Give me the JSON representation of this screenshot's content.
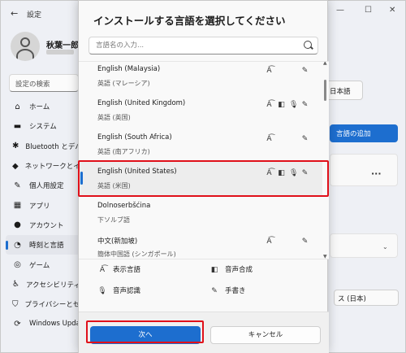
{
  "window": {
    "app_title": "設定",
    "back_glyph": "←",
    "minimize_glyph": "—",
    "maximize_glyph": "☐",
    "close_glyph": "✕"
  },
  "user": {
    "name": "秋葉一郎"
  },
  "sidebar": {
    "search_placeholder": "設定の検索",
    "items": [
      {
        "label": "ホーム",
        "icon": "home-icon",
        "glyph": "⌂"
      },
      {
        "label": "システム",
        "icon": "system-icon",
        "glyph": "▬"
      },
      {
        "label": "Bluetooth とデバ",
        "icon": "bluetooth-icon",
        "glyph": "✱"
      },
      {
        "label": "ネットワークとインタ",
        "icon": "network-icon",
        "glyph": "◆"
      },
      {
        "label": "個人用設定",
        "icon": "personalize-icon",
        "glyph": "✎"
      },
      {
        "label": "アプリ",
        "icon": "apps-icon",
        "glyph": "▦"
      },
      {
        "label": "アカウント",
        "icon": "account-icon",
        "glyph": "●"
      },
      {
        "label": "時刻と言語",
        "icon": "time-language-icon",
        "glyph": "◔",
        "active": true
      },
      {
        "label": "ゲーム",
        "icon": "game-icon",
        "glyph": "◎"
      },
      {
        "label": "アクセシビリティ",
        "icon": "accessibility-icon",
        "glyph": "♿"
      },
      {
        "label": "プライバシーとセキュ",
        "icon": "shield-icon",
        "glyph": "⛉"
      },
      {
        "label": "Windows Upda",
        "icon": "update-icon",
        "glyph": "⟳"
      }
    ]
  },
  "right": {
    "lang_box": "日本語",
    "add_language_label": "言語の追加",
    "region_box": "ス (日本)"
  },
  "dialog": {
    "title": "インストールする言語を選択してください",
    "search_placeholder": "言語名の入力...",
    "languages": [
      {
        "name": "English (Malaysia)",
        "native": "英語 (マレーシア)",
        "features": [
          "display",
          "",
          "",
          "handwriting"
        ]
      },
      {
        "name": "English (United Kingdom)",
        "native": "英語 (英国)",
        "features": [
          "display",
          "speech",
          "recognition",
          "handwriting"
        ]
      },
      {
        "name": "English (South Africa)",
        "native": "英語 (南アフリカ)",
        "features": [
          "display",
          "",
          "",
          "handwriting"
        ]
      },
      {
        "name": "English (United States)",
        "native": "英語 (米国)",
        "features": [
          "display",
          "speech",
          "recognition",
          "handwriting"
        ],
        "selected": true
      },
      {
        "name": "Dolnoserbšćina",
        "native": "下ソルブ語",
        "features": [
          "",
          "",
          "",
          ""
        ]
      },
      {
        "name": "中文(新加坡)",
        "native": "簡体中国語 (シンガポール)",
        "features": [
          "display",
          "",
          "",
          "handwriting"
        ]
      }
    ],
    "legend": {
      "display": "表示言語",
      "speech": "音声合成",
      "recognition": "音声認識",
      "handwriting": "手書き"
    },
    "next_label": "次へ",
    "cancel_label": "キャンセル"
  },
  "colors": {
    "accent": "#1d6ecf",
    "highlight": "#e0101a"
  }
}
